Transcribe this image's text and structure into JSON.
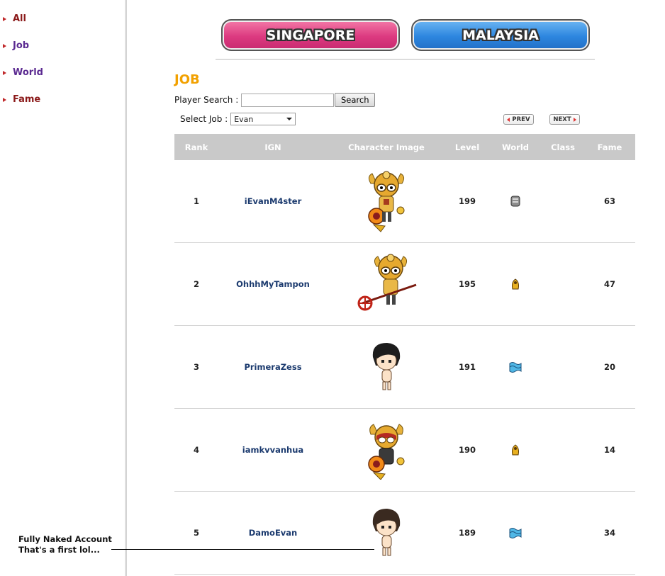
{
  "sidebar": {
    "items": [
      {
        "label": "All",
        "color": "#8b1a1a"
      },
      {
        "label": "Job",
        "color": "#5b2a91"
      },
      {
        "label": "World",
        "color": "#5b2a91"
      },
      {
        "label": "Fame",
        "color": "#8b1a1a"
      }
    ]
  },
  "regions": {
    "singapore": "SINGAPORE",
    "malaysia": "MALAYSIA"
  },
  "page_title": "JOB",
  "search": {
    "label": "Player Search :",
    "value": "",
    "button": "Search"
  },
  "job_select": {
    "label": "Select Job :",
    "value": "Evan"
  },
  "pager": {
    "prev": "PREV",
    "next": "NEXT"
  },
  "table": {
    "headers": [
      "Rank",
      "IGN",
      "Character Image",
      "Level",
      "World",
      "Class",
      "Fame"
    ],
    "rows": [
      {
        "rank": "1",
        "ign": "iEvanM4ster",
        "level": "199",
        "world_icon": "world-icon-stone",
        "class": "",
        "fame": "63"
      },
      {
        "rank": "2",
        "ign": "OhhhMyTampon",
        "level": "195",
        "world_icon": "world-icon-gold",
        "class": "",
        "fame": "47"
      },
      {
        "rank": "3",
        "ign": "PrimeraZess",
        "level": "191",
        "world_icon": "world-icon-wave",
        "class": "",
        "fame": "20"
      },
      {
        "rank": "4",
        "ign": "iamkvvanhua",
        "level": "190",
        "world_icon": "world-icon-gold",
        "class": "",
        "fame": "14"
      },
      {
        "rank": "5",
        "ign": "DamoEvan",
        "level": "189",
        "world_icon": "world-icon-wave",
        "class": "",
        "fame": "34"
      }
    ]
  },
  "annotation": {
    "line1": "Fully Naked Account",
    "line2": "That's a first lol..."
  }
}
